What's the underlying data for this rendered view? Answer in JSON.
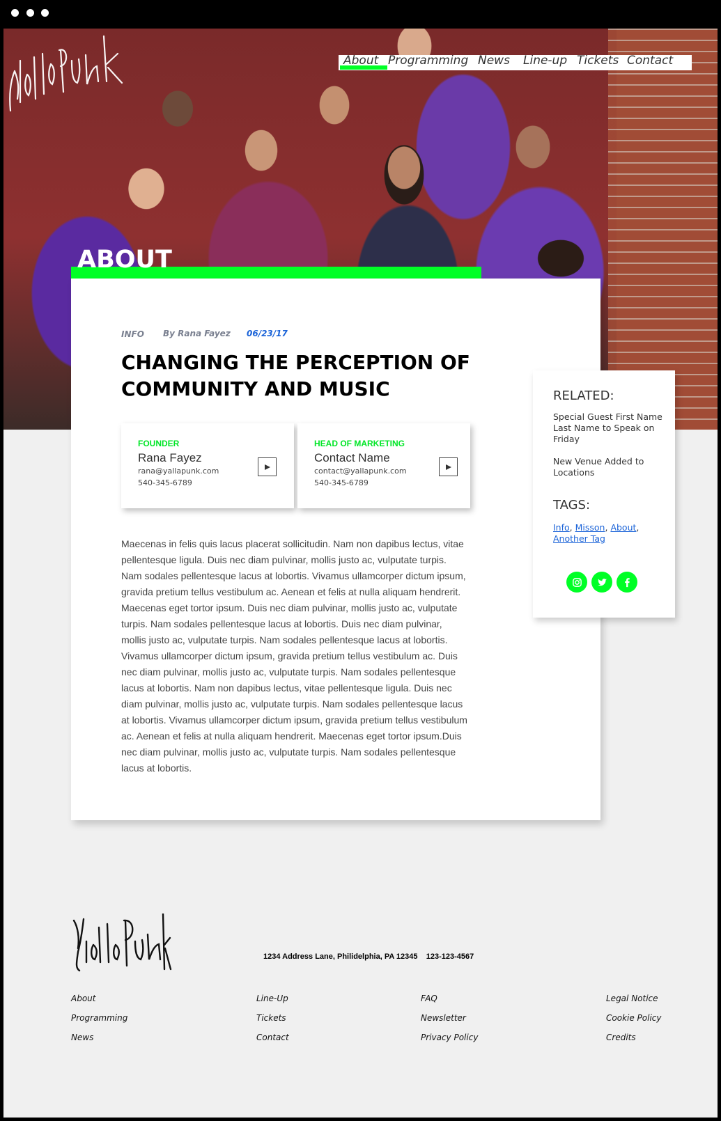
{
  "window": {
    "dots": 3
  },
  "brand": {
    "logo_text": "YallaPunk"
  },
  "nav": {
    "items": [
      {
        "label": "About",
        "active": true
      },
      {
        "label": "Programming"
      },
      {
        "label": "News"
      },
      {
        "label": "Line-up"
      },
      {
        "label": "Tickets"
      },
      {
        "label": "Contact"
      }
    ]
  },
  "colors": {
    "accent": "#00ff26",
    "link": "#1a63d8",
    "background": "#f0f0f0"
  },
  "hero": {
    "heading": "ABOUT"
  },
  "article": {
    "category": "INFO",
    "author": "By Rana Fayez",
    "date": "06/23/17",
    "title": "CHANGING THE PERCEPTION OF COMMUNITY AND MUSIC",
    "contacts": [
      {
        "role": "FOUNDER",
        "name": "Rana Fayez",
        "email": "rana@yallapunk.com",
        "phone": "540-345-6789",
        "icon": "play-icon"
      },
      {
        "role": "HEAD OF MARKETING",
        "name": "Contact Name",
        "email": "contact@yallapunk.com",
        "phone": "540-345-6789",
        "icon": "play-icon"
      }
    ],
    "body": "Maecenas in felis quis lacus placerat sollicitudin. Nam non dapibus lectus, vitae pellentesque ligula. Duis nec diam pulvinar, mollis justo ac, vulputate turpis. Nam sodales pellentesque lacus at lobortis. Vivamus ullamcorper dictum ipsum, gravida pretium tellus vestibulum ac. Aenean et felis at nulla aliquam hendrerit. Maecenas eget tortor ipsum. Duis nec diam pulvinar, mollis justo ac, vulputate turpis. Nam sodales pellentesque lacus at lobortis. Duis nec diam pulvinar, mollis justo ac, vulputate turpis. Nam sodales pellentesque lacus at lobortis. Vivamus ullamcorper dictum ipsum, gravida pretium tellus vestibulum ac. Duis nec diam pulvinar, mollis justo ac, vulputate turpis. Nam sodales pellentesque lacus at lobortis. Nam non dapibus lectus, vitae pellentesque ligula. Duis nec diam pulvinar, mollis justo ac, vulputate turpis. Nam sodales pellentesque lacus at lobortis. Vivamus ullamcorper dictum ipsum, gravida pretium tellus vestibulum ac. Aenean et felis at nulla aliquam hendrerit. Maecenas eget tortor ipsum.Duis nec diam pulvinar, mollis justo ac, vulputate turpis. Nam sodales pellentesque lacus at lobortis."
  },
  "sidebar": {
    "related_heading": "RELATED:",
    "related": [
      "Special Guest First Name Last Name to Speak on Friday",
      "New Venue Added to Locations"
    ],
    "tags_heading": "TAGS:",
    "tags": [
      "Info",
      "Misson",
      "About",
      "Another Tag"
    ],
    "social": [
      "instagram-icon",
      "twitter-icon",
      "facebook-icon"
    ]
  },
  "footer": {
    "address": "1234 Address Lane, Philidelphia, PA 12345",
    "phone": "123-123-4567",
    "columns": [
      [
        "About",
        "Programming",
        "News"
      ],
      [
        "Line-Up",
        "Tickets",
        "Contact"
      ],
      [
        "FAQ",
        "Newsletter",
        "Privacy Policy"
      ],
      [
        "Legal Notice",
        "Cookie Policy",
        "Credits"
      ]
    ]
  }
}
